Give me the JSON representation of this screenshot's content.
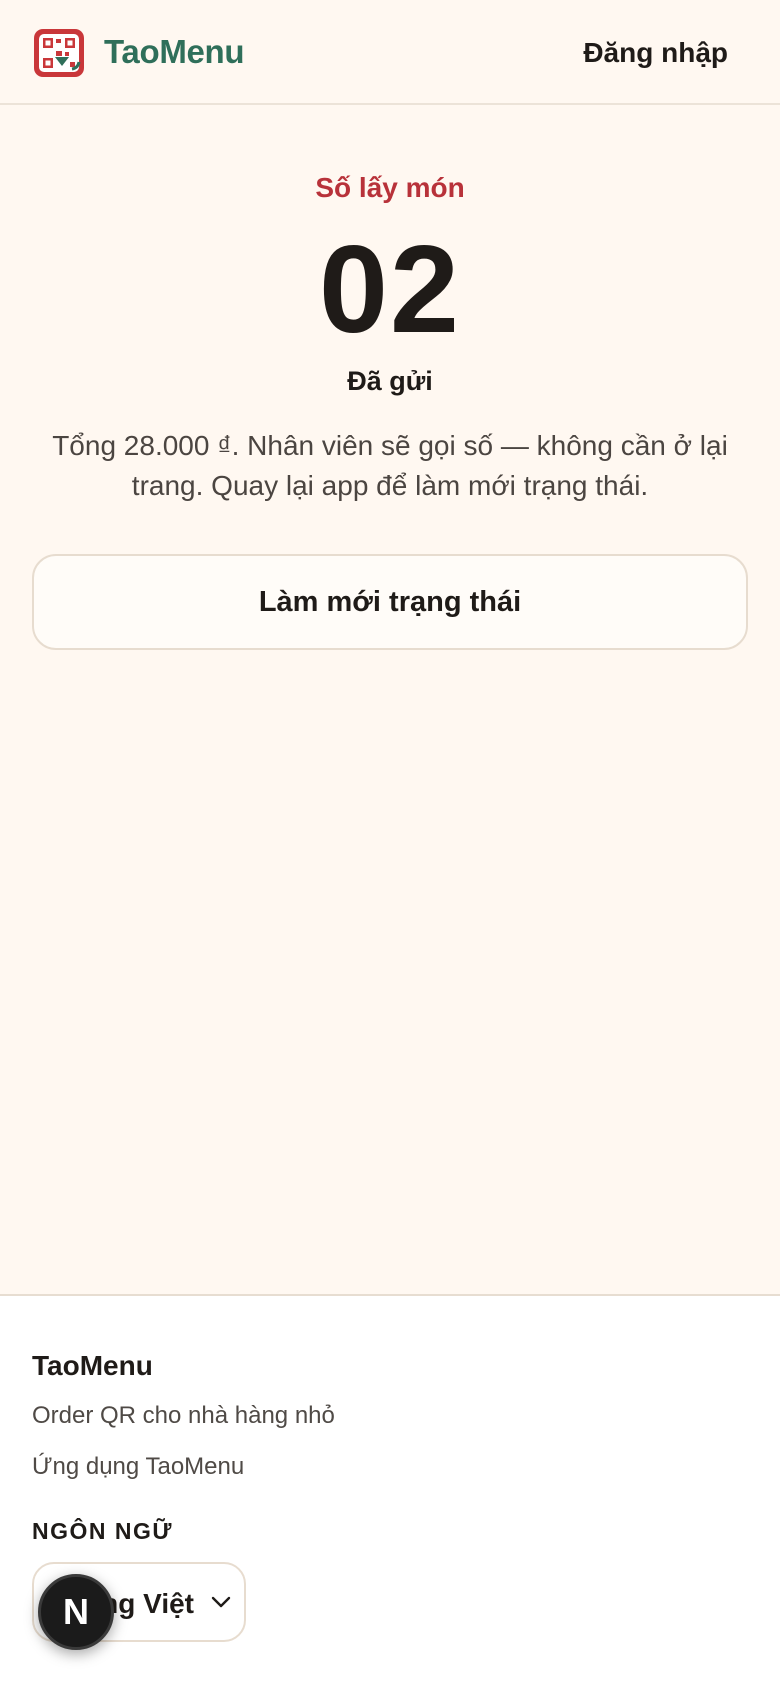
{
  "header": {
    "brand": "TaoMenu",
    "logo_icon": "qr-menu-icon",
    "login_label": "Đăng nhập"
  },
  "order": {
    "pickup_label": "Số lấy món",
    "pickup_number": "02",
    "status": "Đã gửi",
    "description": "Tổng 28.000 ₫. Nhân viên sẽ gọi số — không cần ở lại trang. Quay lại app để làm mới trạng thái.",
    "refresh_label": "Làm mới trạng thái"
  },
  "footer": {
    "title": "TaoMenu",
    "tagline": "Order QR cho nhà hàng nhỏ",
    "app_link": "Ứng dụng TaoMenu",
    "language_heading": "NGÔN NGỮ",
    "language_value": "ng Việt"
  },
  "dev_badge": {
    "letter": "N"
  },
  "colors": {
    "background": "#fff8f1",
    "brand_green": "#2f6f5a",
    "accent_red": "#b8323a",
    "logo_red": "#c9373a"
  }
}
